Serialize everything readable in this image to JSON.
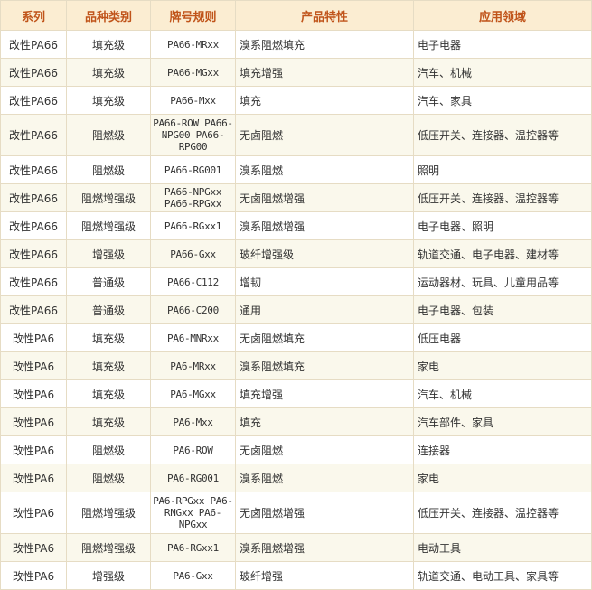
{
  "headers": [
    "系列",
    "品种类别",
    "牌号规则",
    "产品特性",
    "应用领域"
  ],
  "rows": [
    [
      "改性PA66",
      "填充级",
      "PA66-MRxx",
      "溴系阻燃填充",
      "电子电器"
    ],
    [
      "改性PA66",
      "填充级",
      "PA66-MGxx",
      "填充增强",
      "汽车、机械"
    ],
    [
      "改性PA66",
      "填充级",
      "PA66-Mxx",
      "填充",
      "汽车、家具"
    ],
    [
      "改性PA66",
      "阻燃级",
      "PA66-ROW PA66-NPG00 PA66-RPG00",
      "无卤阻燃",
      "低压开关、连接器、温控器等"
    ],
    [
      "改性PA66",
      "阻燃级",
      "PA66-RG001",
      "溴系阻燃",
      "照明"
    ],
    [
      "改性PA66",
      "阻燃增强级",
      "PA66-NPGxx PA66-RPGxx",
      "无卤阻燃增强",
      "低压开关、连接器、温控器等"
    ],
    [
      "改性PA66",
      "阻燃增强级",
      "PA66-RGxx1",
      "溴系阻燃增强",
      "电子电器、照明"
    ],
    [
      "改性PA66",
      "增强级",
      "PA66-Gxx",
      "玻纤增强级",
      "轨道交通、电子电器、建材等"
    ],
    [
      "改性PA66",
      "普通级",
      "PA66-C112",
      "增韧",
      "运动器材、玩具、儿童用品等"
    ],
    [
      "改性PA66",
      "普通级",
      "PA66-C200",
      "通用",
      "电子电器、包装"
    ],
    [
      "改性PA6",
      "填充级",
      "PA6-MNRxx",
      "无卤阻燃填充",
      "低压电器"
    ],
    [
      "改性PA6",
      "填充级",
      "PA6-MRxx",
      "溴系阻燃填充",
      "家电"
    ],
    [
      "改性PA6",
      "填充级",
      "PA6-MGxx",
      "填充增强",
      "汽车、机械"
    ],
    [
      "改性PA6",
      "填充级",
      "PA6-Mxx",
      "填充",
      "汽车部件、家具"
    ],
    [
      "改性PA6",
      "阻燃级",
      "PA6-ROW",
      "无卤阻燃",
      "连接器"
    ],
    [
      "改性PA6",
      "阻燃级",
      "PA6-RG001",
      "溴系阻燃",
      "家电"
    ],
    [
      "改性PA6",
      "阻燃增强级",
      "PA6-RPGxx PA6-RNGxx PA6-NPGxx",
      "无卤阻燃增强",
      "低压开关、连接器、温控器等"
    ],
    [
      "改性PA6",
      "阻燃增强级",
      "PA6-RGxx1",
      "溴系阻燃增强",
      "电动工具"
    ],
    [
      "改性PA6",
      "增强级",
      "PA6-Gxx",
      "玻纤增强",
      "轨道交通、电动工具、家具等"
    ]
  ],
  "tall_rows": [
    3,
    16
  ]
}
